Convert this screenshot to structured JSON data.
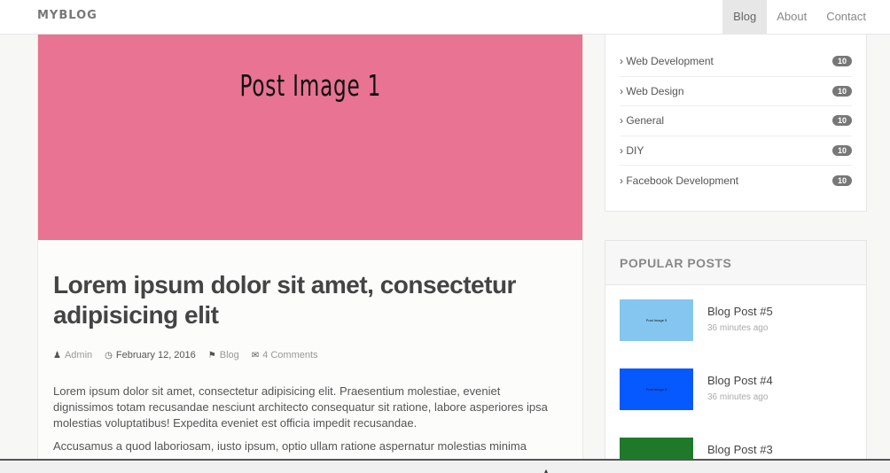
{
  "navbar": {
    "brand": "MYBLOG",
    "links": [
      "Blog",
      "About",
      "Contact"
    ]
  },
  "post": {
    "image_text": "Post Image 1",
    "image_color": "#e87392",
    "title": "Lorem ipsum dolor sit amet, consectetur adipisicing elit",
    "meta": {
      "author": "Admin",
      "date": "February 12, 2016",
      "category": "Blog",
      "comments": "4 Comments"
    },
    "paragraphs": [
      "Lorem ipsum dolor sit amet, consectetur adipisicing elit. Praesentium molestiae, eveniet dignissimos totam recusandae nesciunt architecto consequatur sit ratione, labore asperiores ipsa molestias voluptatibus! Expedita eveniet est officia impedit recusandae.",
      "Accusamus a quod laboriosam, iusto ipsum, optio ullam ratione aspernatur molestias minima"
    ]
  },
  "sidebar": {
    "categories": [
      {
        "label": "Web Development",
        "count": "10"
      },
      {
        "label": "Web Design",
        "count": "10"
      },
      {
        "label": "General",
        "count": "10"
      },
      {
        "label": "DIY",
        "count": "10"
      },
      {
        "label": "Facebook Development",
        "count": "10"
      }
    ],
    "popular": {
      "heading": "POPULAR POSTS",
      "posts": [
        {
          "title": "Blog Post #5",
          "time": "36 minutes ago",
          "thumb_text": "Post Image 5",
          "thumb_color": "#85c6f0"
        },
        {
          "title": "Blog Post #4",
          "time": "36 minutes ago",
          "thumb_text": "Post Image 4",
          "thumb_color": "#0559ff"
        },
        {
          "title": "Blog Post #3",
          "time": "",
          "thumb_text": "",
          "thumb_color": "#1e7a2a"
        }
      ]
    }
  }
}
